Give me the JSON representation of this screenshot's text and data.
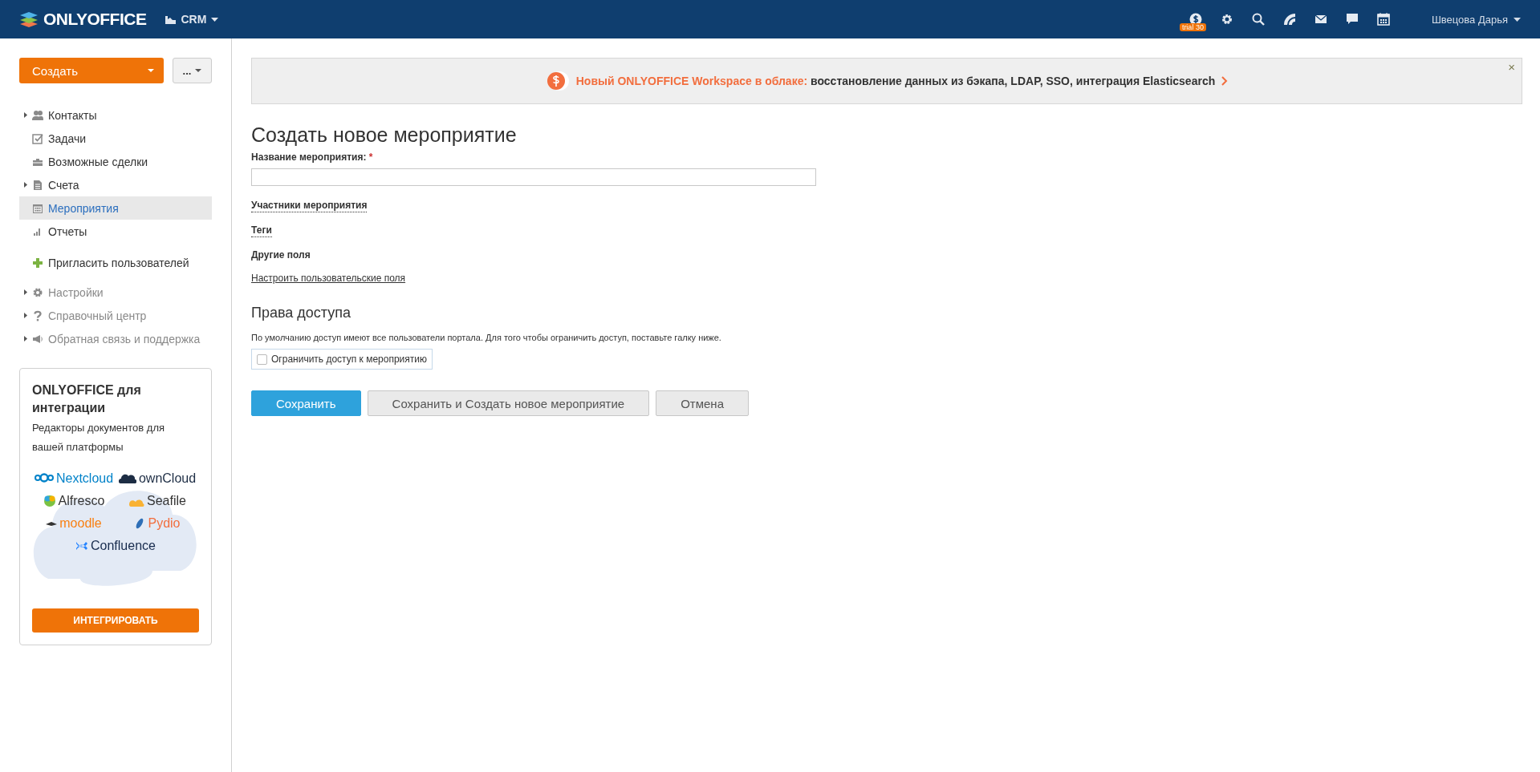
{
  "header": {
    "logo": "ONLYOFFICE",
    "module": "CRM",
    "trial_badge": "trial 30",
    "user": "Швецова Дарья"
  },
  "sidebar": {
    "create_button": "Создать",
    "more_button": "...",
    "items": [
      {
        "label": "Контакты",
        "kind": "group",
        "selected": false
      },
      {
        "label": "Задачи",
        "kind": "link",
        "selected": false
      },
      {
        "label": "Возможные сделки",
        "kind": "link",
        "selected": false
      },
      {
        "label": "Счета",
        "kind": "group",
        "selected": false
      },
      {
        "label": "Мероприятия",
        "kind": "link",
        "selected": true
      },
      {
        "label": "Отчеты",
        "kind": "link",
        "selected": false
      }
    ],
    "invite": "Пригласить пользователей",
    "bottom_items": [
      {
        "label": "Настройки",
        "kind": "group"
      },
      {
        "label": "Справочный центр",
        "kind": "group"
      },
      {
        "label": "Обратная связь и поддержка",
        "kind": "group"
      }
    ],
    "promo": {
      "title": "ONLYOFFICE для интеграции",
      "subtitle": "Редакторы документов для вашей платформы",
      "partners": [
        "Nextcloud",
        "ownCloud",
        "Alfresco",
        "Seafile",
        "moodle",
        "Pydio",
        "Confluence"
      ],
      "button": "ИНТЕГРИРОВАТЬ"
    }
  },
  "banner": {
    "highlight": "Новый ONLYOFFICE Workspace в облаке:",
    "text": "восстановление данных из бэкапа, LDAP, SSO, интеграция Elasticsearch",
    "close": "×"
  },
  "form": {
    "title": "Создать новое мероприятие",
    "name_label": "Название мероприятия:",
    "required_mark": "*",
    "sections": [
      {
        "label": "Участники мероприятия",
        "kind": "toggle"
      },
      {
        "label": "Теги",
        "kind": "toggle"
      },
      {
        "label": "Другие поля",
        "kind": "heading"
      }
    ],
    "custom_fields_link": "Настроить пользовательские поля",
    "access": {
      "title": "Права доступа",
      "note": "По умолчанию доступ имеют все пользователи портала. Для того чтобы ограничить доступ, поставьте галку ниже.",
      "restrict_label": "Ограничить доступ к мероприятию",
      "checked": false
    },
    "buttons": [
      {
        "label": "Сохранить",
        "kind": "primary"
      },
      {
        "label": "Сохранить и Создать новое мероприятие",
        "kind": "secondary"
      },
      {
        "label": "Отмена",
        "kind": "secondary"
      }
    ]
  }
}
